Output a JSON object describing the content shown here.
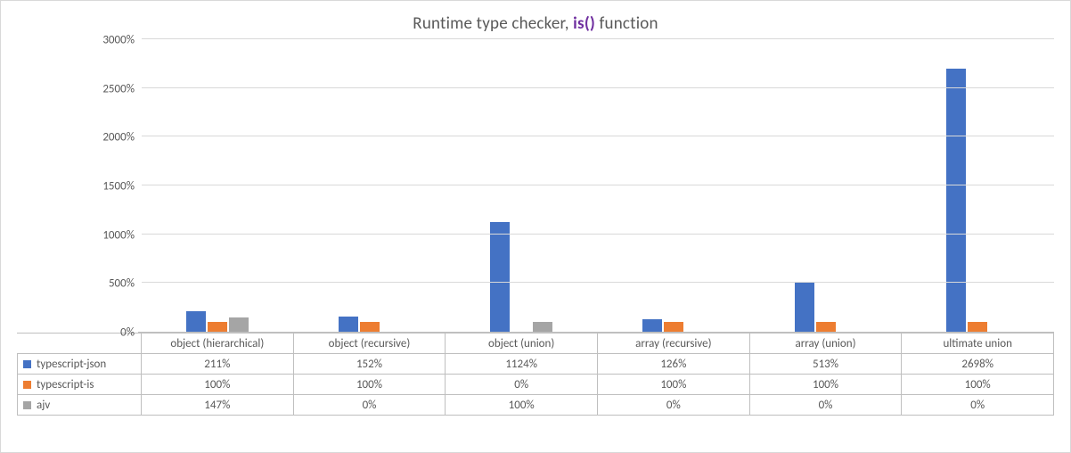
{
  "chart_data": {
    "type": "bar",
    "title_prefix": "Runtime type checker, ",
    "title_accent": "is()",
    "title_suffix": " function",
    "categories": [
      "object (hierarchical)",
      "object (recursive)",
      "object (union)",
      "array (recursive)",
      "array (union)",
      "ultimate union"
    ],
    "series": [
      {
        "name": "typescript-json",
        "values": [
          211,
          152,
          1124,
          126,
          513,
          2698
        ]
      },
      {
        "name": "typescript-is",
        "values": [
          100,
          100,
          0,
          100,
          100,
          100
        ]
      },
      {
        "name": "ajv",
        "values": [
          147,
          0,
          100,
          0,
          0,
          0
        ]
      }
    ],
    "y_ticks": [
      0,
      500,
      1000,
      1500,
      2000,
      2500,
      3000
    ],
    "ylim": [
      0,
      3000
    ],
    "value_suffix": "%",
    "xlabel": "",
    "ylabel": ""
  },
  "colors": {
    "series": [
      "#4472C4",
      "#ED7D31",
      "#A5A5A5"
    ],
    "accent": "#7030A0"
  }
}
